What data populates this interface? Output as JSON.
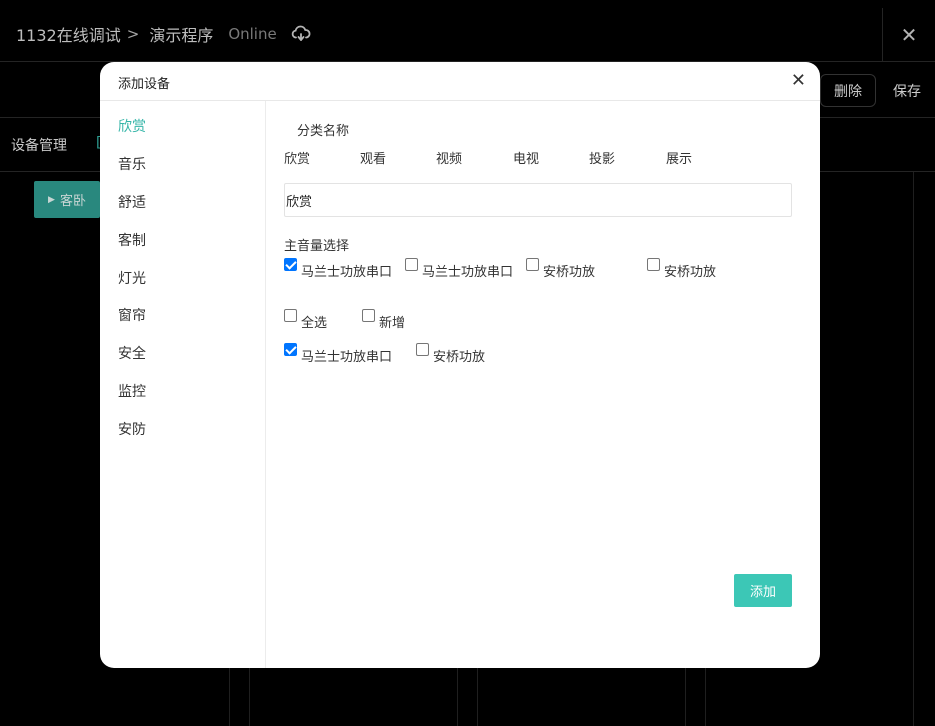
{
  "app": {
    "breadcrumb": [
      "1132在线调试",
      "演示程序"
    ],
    "breadcrumb_sep": ">",
    "status": "Online",
    "close_glyph": "✕"
  },
  "toolbar": {
    "delete_label": "删除",
    "save_label": "保存"
  },
  "subnav": {
    "device_mgmt": "设备管理",
    "partial_item": "["
  },
  "room_tag": "客卧",
  "modal": {
    "title": "添加设备",
    "close_glyph": "✕",
    "side_menu": [
      "欣赏",
      "音乐",
      "舒适",
      "客制",
      "灯光",
      "窗帘",
      "安全",
      "监控",
      "安防"
    ],
    "active_index": 0,
    "category_label": "分类名称",
    "category_tabs": [
      "欣赏",
      "观看",
      "视频",
      "电视",
      "投影",
      "展示"
    ],
    "name_value": "欣赏",
    "volume_label": "主音量选择",
    "volume_options": [
      {
        "label": "马兰士功放串口",
        "checked": true
      },
      {
        "label": "马兰士功放串口",
        "checked": false
      },
      {
        "label": "安桥功放",
        "checked": false
      },
      {
        "label": "安桥功放",
        "checked": false
      }
    ],
    "select_all_label": "全选",
    "add_new_label": "新增",
    "selected_options": [
      {
        "label": "马兰士功放串口",
        "checked": true
      },
      {
        "label": "安桥功放",
        "checked": false
      }
    ],
    "add_button": "添加"
  },
  "colors": {
    "accent": "#35b5a8",
    "add_button": "#3cc7b6",
    "room_tag": "#2f9b90",
    "checkbox_checked": "#0075ff"
  },
  "icons": {
    "cloud": "cloud-sync-icon",
    "close": "close-icon",
    "caret": "caret-right-icon"
  }
}
